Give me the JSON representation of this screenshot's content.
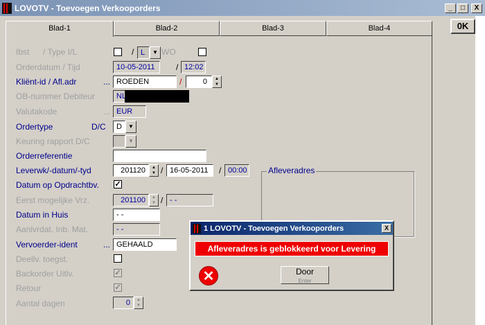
{
  "window": {
    "title": "LOVOTV - Toevoegen Verkooporders",
    "minimize_glyph": "_",
    "maximize_glyph": "□",
    "close_glyph": "X"
  },
  "ok_label": "0K",
  "tabs": [
    "Blad-1",
    "Blad-2",
    "Blad-3",
    "Blad-4"
  ],
  "form": {
    "ibst_label": "Ibst",
    "type_label": "/ Type I/L",
    "type_sep": "/",
    "type_value": "L",
    "wo_label": "WO",
    "orderdatum_label": "Orderdatum / Tijd",
    "orderdatum": "10-05-2011",
    "tijd": "12:02",
    "klient_label": "Kliënt-id / Afl.adr",
    "klient_dots": "...",
    "klient_value": "ROEDEN",
    "afl_adr_value": "0",
    "ob_label": "OB-nummer Debiteur",
    "ob_value": "NL",
    "valuta_label": "Valutakode",
    "valuta_dots": "...",
    "valuta_value": "EUR",
    "ordertype_label": "Ordertype",
    "dc_label": "D/C",
    "ordertype_value": "D",
    "keuring_label": "Keuring rapport D/C",
    "orderref_label": "Orderreferentie",
    "orderref_value": "",
    "leverwk_label": "Leverwk/-datum/-tyd",
    "leverwk_value": "201120",
    "leverdatum_value": "16-05-2011",
    "levertijd_value": "00:00",
    "datum_opdracht_label": "Datum op Opdrachtbv.",
    "datum_opdracht_checked": "✓",
    "eerst_label": "Eerst mogelijke Vrz.",
    "eerst_value": "201100",
    "eerst_date": "- -",
    "datum_huis_label": "Datum in Huis",
    "datum_huis_value": "- -",
    "aanlvrdat_label": "Aanlvrdat. Inb. Mat.",
    "aanlvrdat_value": "- -",
    "vervoerder_label": "Vervoerder-ident",
    "vervoerder_dots": "...",
    "vervoerder_value": "GEHAALD",
    "deellv_label": "Deellv. toegst.",
    "backorder_label": "Backorder Uitlv.",
    "backorder_checked": "✓",
    "retour_label": "Retour",
    "retour_checked": "✓",
    "aantal_label": "Aantal dagen",
    "aantal_value": "0",
    "afleveradres_label": "Afleveradres"
  },
  "dialog": {
    "title": "1 LOVOTV - Toevoegen Verkooporders",
    "close_glyph": "X",
    "message": "Afleveradres is geblokkeerd voor Levering",
    "button_label": "Door",
    "button_sub": "Enter",
    "error_glyph": "✕"
  },
  "colors": {
    "title_gradient_start": "#7b93b5",
    "dialog_title": "#0a246a",
    "error_bar": "#ee0000",
    "label_blue": "#00008b"
  }
}
